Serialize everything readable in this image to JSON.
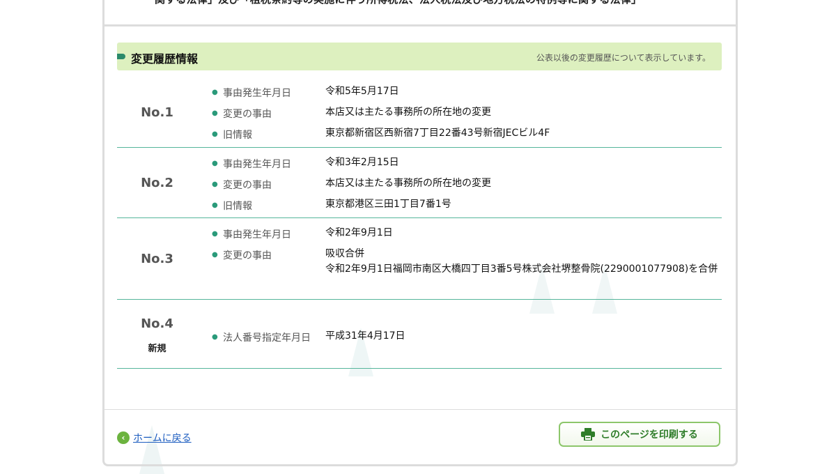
{
  "top_text": "関する法律」及び「租税条約等の実施に伴う所得税法、法人税法及び地方税法の特例等に関する法律」",
  "section": {
    "title": "変更履歴情報",
    "note": "公表以後の変更履歴について表示しています。"
  },
  "entries": [
    {
      "no": "No.1",
      "rows": [
        {
          "label": "事由発生年月日",
          "value": "令和5年5月17日"
        },
        {
          "label": "変更の事由",
          "value": "本店又は主たる事務所の所在地の変更"
        },
        {
          "label": "旧情報",
          "value": "東京都新宿区西新宿7丁目22番43号新宿JECビル4F"
        }
      ]
    },
    {
      "no": "No.2",
      "rows": [
        {
          "label": "事由発生年月日",
          "value": "令和3年2月15日"
        },
        {
          "label": "変更の事由",
          "value": "本店又は主たる事務所の所在地の変更"
        },
        {
          "label": "旧情報",
          "value": "東京都港区三田1丁目7番1号"
        }
      ]
    },
    {
      "no": "No.3",
      "rows": [
        {
          "label": "事由発生年月日",
          "value": "令和2年9月1日"
        },
        {
          "label": "変更の事由",
          "value": "吸収合併",
          "value2": "令和2年9月1日福岡市南区大橋四丁目3番5号株式会社堺整骨院(2290001077908)を合併"
        }
      ]
    },
    {
      "no": "No.4",
      "badge": "新規",
      "rows": [
        {
          "label": "法人番号指定年月日",
          "value": "平成31年4月17日"
        }
      ]
    }
  ],
  "footer": {
    "home_link": "ホームに戻る",
    "print_button": "このページを印刷する"
  },
  "colors": {
    "header_bg": "#ddf0bf",
    "divider": "#55b59a",
    "accent_green": "#6cb33f",
    "link_blue": "#1a5bbf"
  },
  "icons": {
    "home": "chevron-left-circle-icon",
    "print": "printer-icon",
    "bullet": "bullet-dot-icon"
  }
}
